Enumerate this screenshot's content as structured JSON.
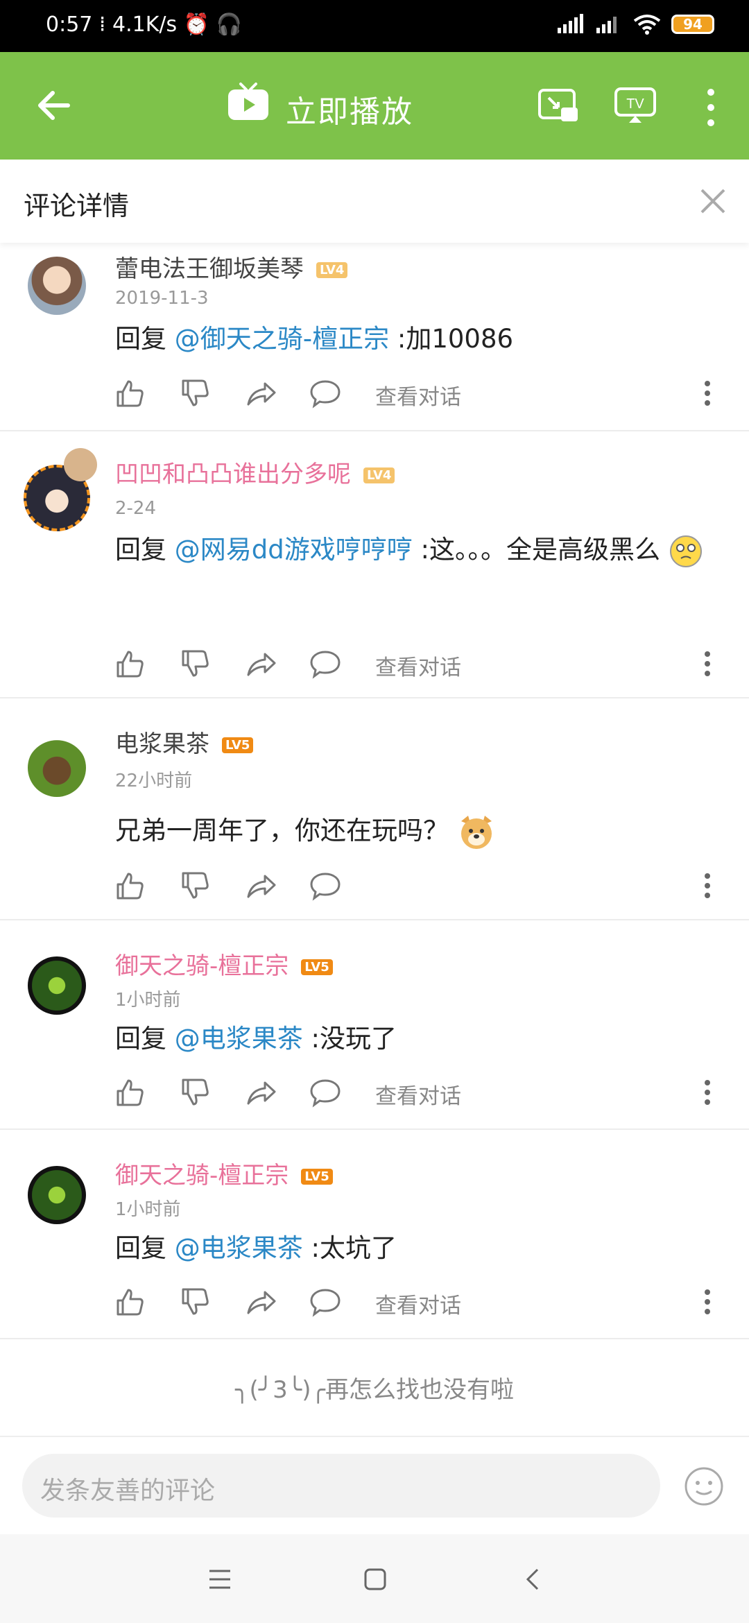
{
  "status_bar": {
    "time": "0:57",
    "speed": "4.1K/s",
    "battery": "94"
  },
  "app_bar": {
    "title": "立即播放"
  },
  "sheet": {
    "title": "评论详情"
  },
  "comments": [
    {
      "username": "蕾电法王御坂美琴",
      "level": "LV4",
      "date": "2019-11-3",
      "reply_prefix": "回复 ",
      "mention": "@御天之骑-檀正宗",
      "text": " :加10086",
      "view_conversation": "查看对话"
    },
    {
      "username": "凹凹和凸凸谁出分多呢",
      "level": "LV4",
      "date": "2-24",
      "reply_prefix": "回复 ",
      "mention": "@网易dd游戏哼哼哼",
      "text": " :这。。。全是高级黑么",
      "view_conversation": "查看对话"
    },
    {
      "username": "电浆果茶",
      "level": "LV5",
      "date": "22小时前",
      "text": "兄弟一周年了，你还在玩吗？"
    },
    {
      "username": "御天之骑-檀正宗",
      "level": "LV5",
      "date": "1小时前",
      "reply_prefix": "回复 ",
      "mention": "@电浆果茶",
      "text": " :没玩了",
      "view_conversation": "查看对话"
    },
    {
      "username": "御天之骑-檀正宗",
      "level": "LV5",
      "date": "1小时前",
      "reply_prefix": "回复 ",
      "mention": "@电浆果茶",
      "text": " :太坑了",
      "view_conversation": "查看对话"
    }
  ],
  "end_text": "╮(╯3╰)╭再怎么找也没有啦",
  "input": {
    "placeholder": "发条友善的评论"
  },
  "colors": {
    "accent": "#7ec24a",
    "mention": "#2b88c6",
    "pink_name": "#e8719a"
  }
}
